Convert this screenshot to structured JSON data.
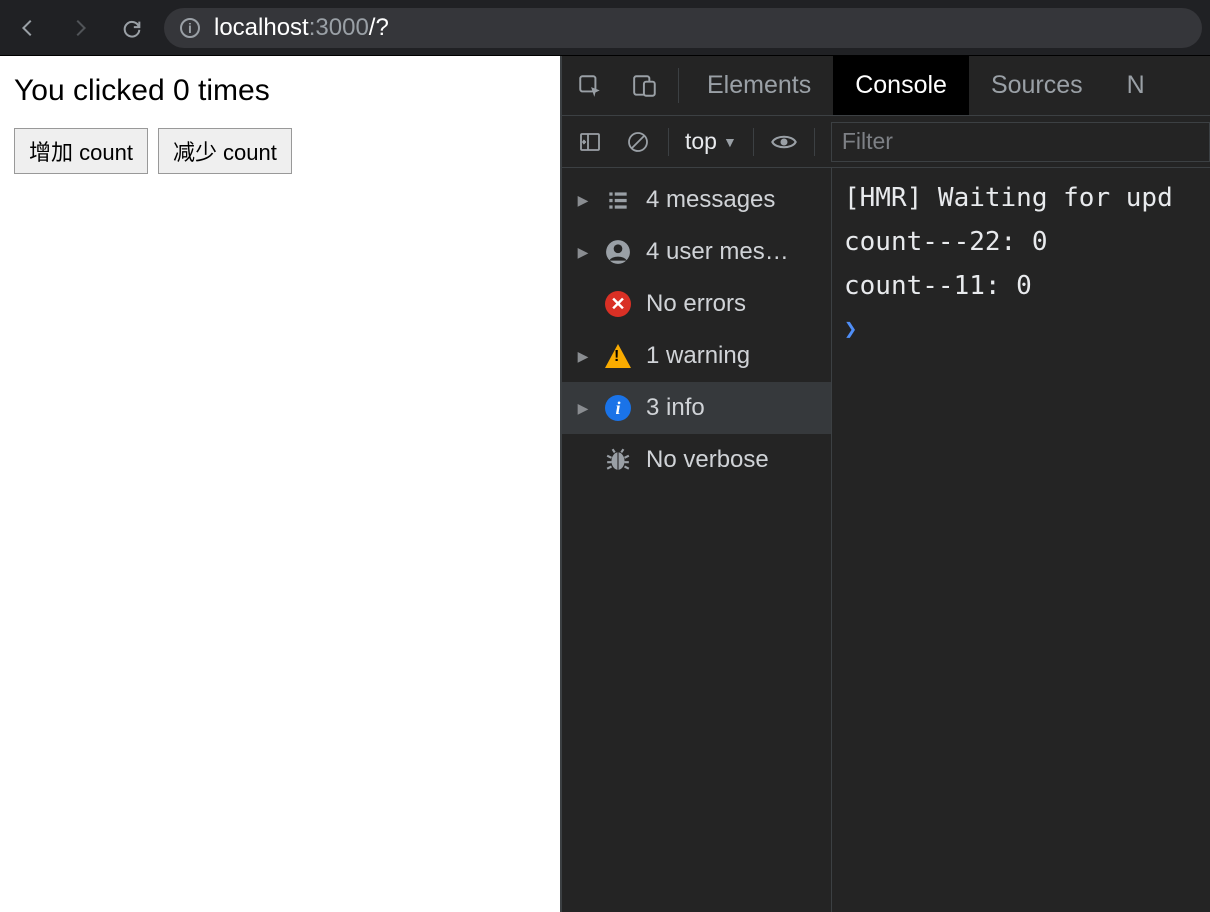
{
  "browser": {
    "url_dim_prefix": "localhost",
    "url_dim_port": ":3000",
    "url_bright_path": "/?"
  },
  "page": {
    "heading": "You clicked 0 times",
    "increase_label": "增加 count",
    "decrease_label": "减少 count"
  },
  "devtools": {
    "tabs": {
      "elements": "Elements",
      "console": "Console",
      "sources": "Sources",
      "more": "N"
    },
    "filterbar": {
      "context": "top",
      "filter_placeholder": "Filter"
    },
    "sidebar": {
      "messages": "4 messages",
      "user_messages": "4 user mes…",
      "errors": "No errors",
      "warnings": "1 warning",
      "info": "3 info",
      "verbose": "No verbose"
    },
    "console_lines": [
      "[HMR] Waiting for upd",
      "count---22: 0",
      "count--11: 0"
    ]
  }
}
